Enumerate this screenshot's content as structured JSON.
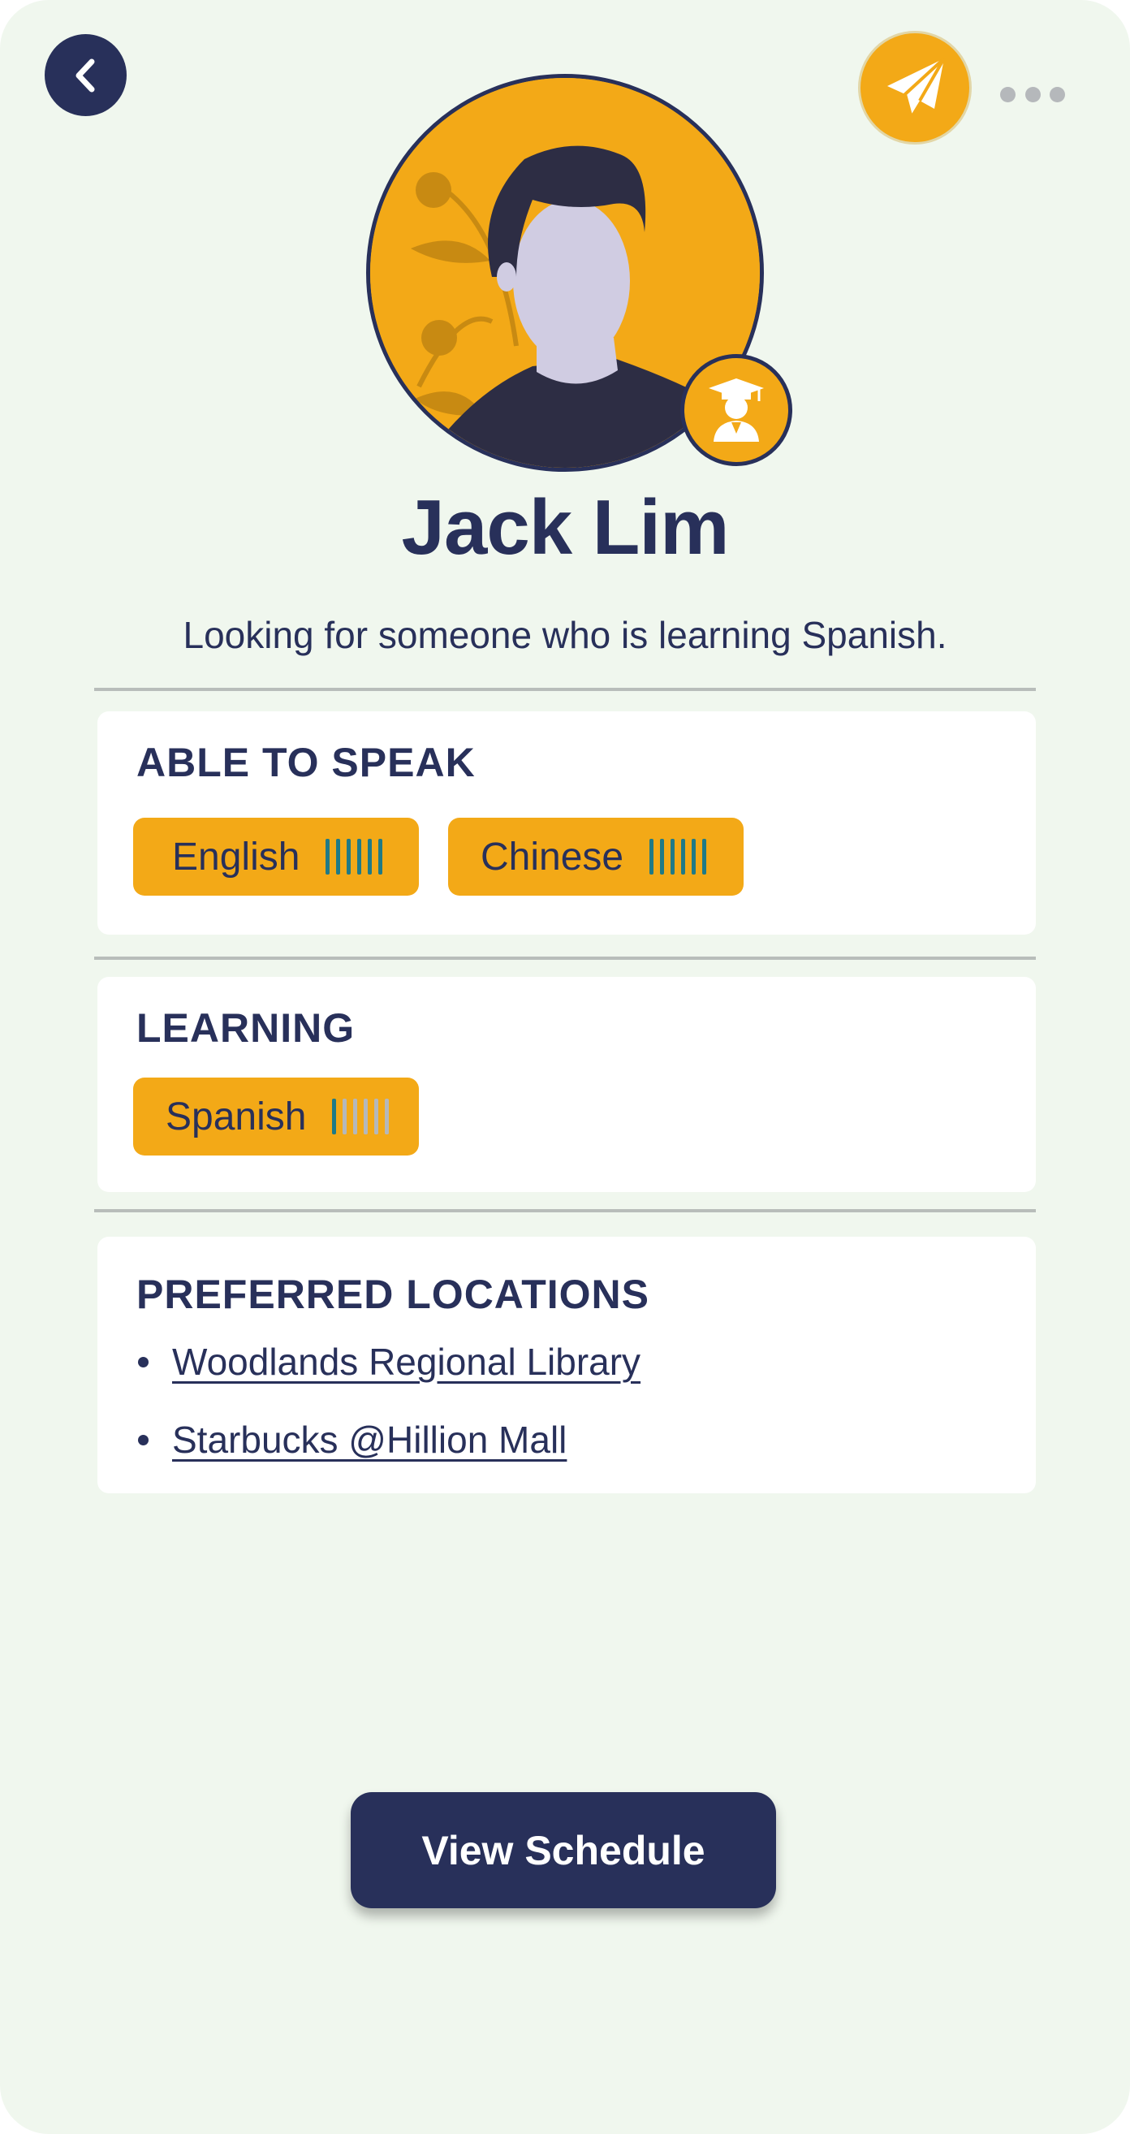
{
  "header": {
    "back_icon": "chevron-left-icon",
    "send_icon": "paper-plane-icon",
    "more_icon": "more-horizontal-icon"
  },
  "profile": {
    "name": "Jack Lim",
    "bio": "Looking for someone who is learning Spanish.",
    "badge_icon": "graduate-icon"
  },
  "sections": {
    "able_to_speak": {
      "title": "ABLE TO SPEAK",
      "languages": [
        {
          "name": "English",
          "level": 6,
          "max_level": 6
        },
        {
          "name": "Chinese",
          "level": 6,
          "max_level": 6
        }
      ]
    },
    "learning": {
      "title": "LEARNING",
      "languages": [
        {
          "name": "Spanish",
          "level": 1,
          "max_level": 6
        }
      ]
    },
    "preferred_locations": {
      "title": "PREFERRED LOCATIONS",
      "locations": [
        "Woodlands Regional Library",
        "Starbucks @Hillion Mall"
      ]
    }
  },
  "actions": {
    "view_schedule_label": "View Schedule"
  },
  "colors": {
    "background": "#F0F7EE",
    "navy": "#28305A",
    "accent": "#F3A917",
    "level_on": "#1F7A86",
    "level_off": "#B5B8BB",
    "divider": "#B8BDBA"
  }
}
